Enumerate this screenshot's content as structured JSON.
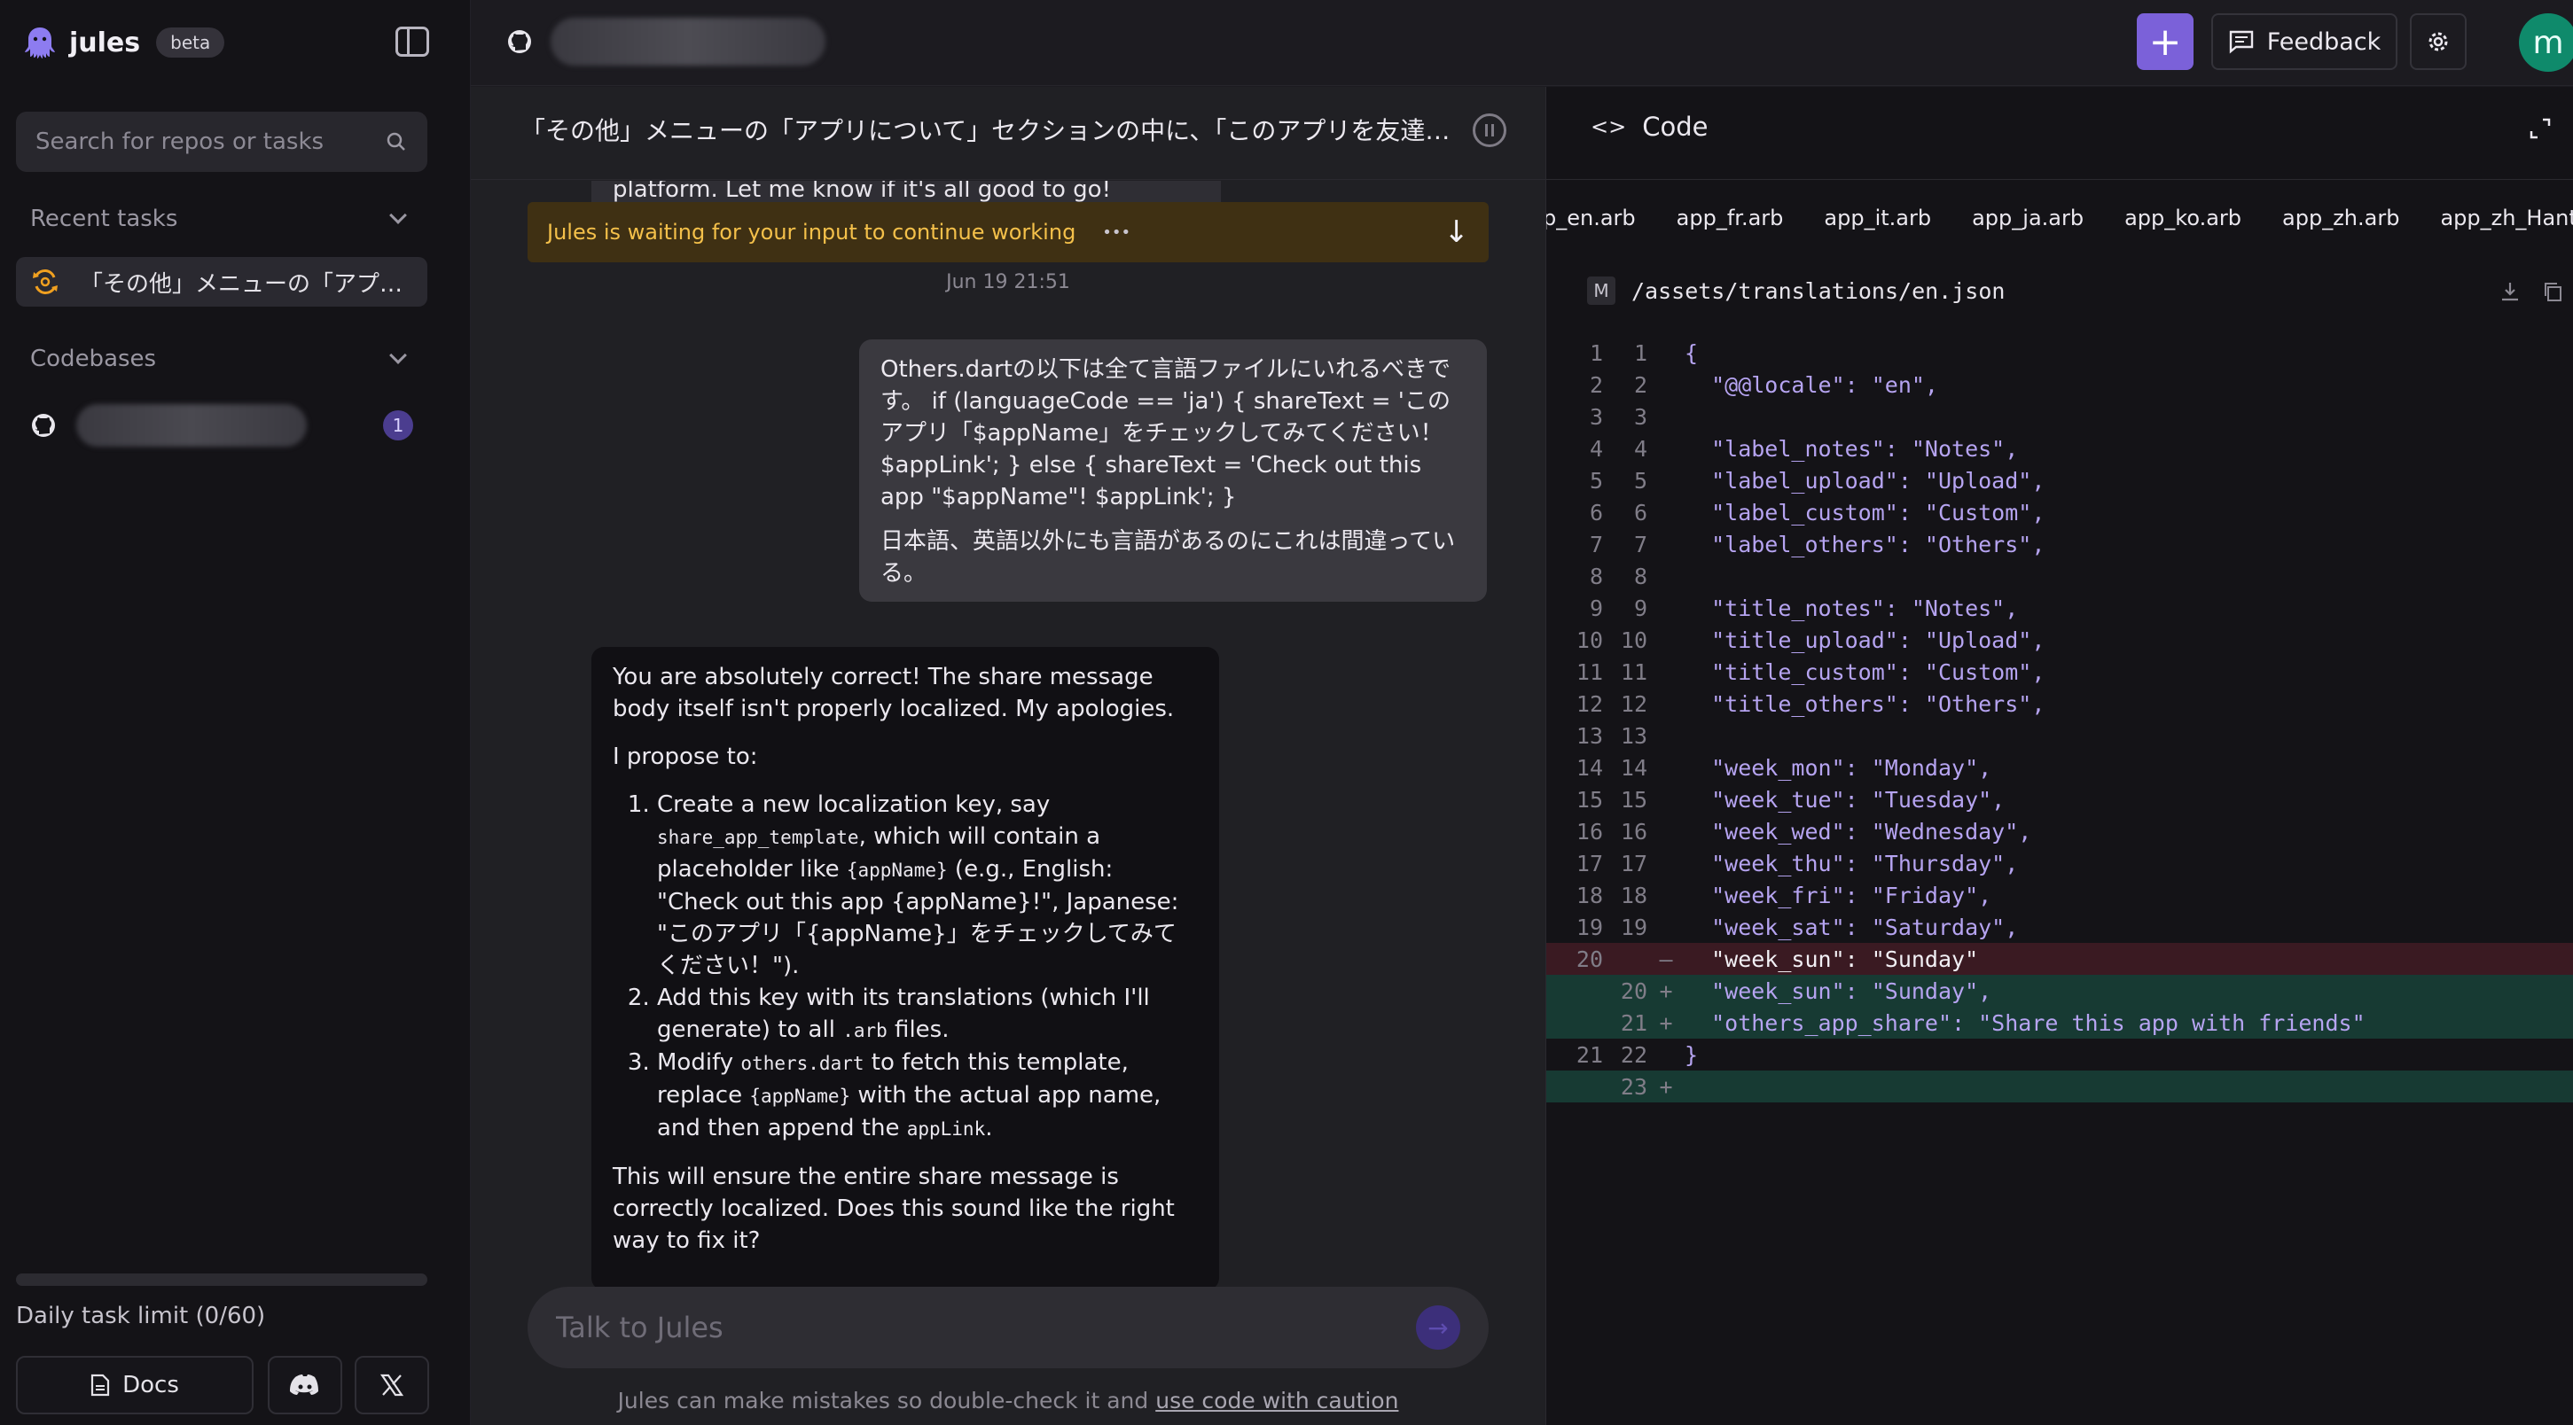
{
  "sidebar": {
    "brand": "jules",
    "badge": "beta",
    "search_placeholder": "Search for repos or tasks",
    "recent_label": "Recent tasks",
    "task_title": "「その他」メニューの「アプ…",
    "codebases_label": "Codebases",
    "codebase_count": "1",
    "limit_text": "Daily task limit (0/60)",
    "docs_label": "Docs"
  },
  "topbar": {
    "feedback_label": "Feedback",
    "avatar_letter": "m",
    "accent": "#7b61d9"
  },
  "chat": {
    "title": "「その他」メニューの「アプリについて」セクションの中に、「このアプリを友達…",
    "cut_text": "platform. Let me know if it's all good to go!",
    "waiting_text": "Jules is waiting for your input to continue working",
    "waiting_dots": "•••",
    "timestamp": "Jun 19 21:51",
    "user_p1": "Others.dartの以下は全て言語ファイルにいれるべきです。 if (languageCode == 'ja') { shareText = 'このアプリ「$appName」をチェックしてみてください！ $appLink'; } else { shareText = 'Check out this app \"$appName\"! $appLink'; }",
    "user_p2": "日本語、英語以外にも言語があるのにこれは間違っている。",
    "bot_p1": "You are absolutely correct! The share message body itself isn't properly localized. My apologies.",
    "bot_p2": "I propose to:",
    "bot_list": {
      "i1_a": "Create a new localization key, say ",
      "i1_code": "share_app_template",
      "i1_b": ", which will contain a placeholder like ",
      "i1_code2": "{appName}",
      "i1_c": " (e.g., English: \"Check out this app {appName}!\", Japanese: \"このアプリ「{appName}」をチェックしてみてください！\").",
      "i2_a": "Add this key with its translations (which I'll generate) to all ",
      "i2_code": ".arb",
      "i2_b": " files.",
      "i3_a": "Modify ",
      "i3_code": "others.dart",
      "i3_b": " to fetch this template, replace ",
      "i3_code2": "{appName}",
      "i3_c": " with the actual app name, and then append the ",
      "i3_code3": "appLink",
      "i3_d": "."
    },
    "bot_p3": "This will ensure the entire share message is correctly localized. Does this sound like the right way to fix it?",
    "input_placeholder": "Talk to Jules",
    "disclaimer": "Jules can make mistakes so double-check it and ",
    "disclaimer_link": "use code with caution"
  },
  "code": {
    "header": "Code",
    "file_tabs": [
      "p_en.arb",
      "app_fr.arb",
      "app_it.arb",
      "app_ja.arb",
      "app_ko.arb",
      "app_zh.arb",
      "app_zh_Hant.arb"
    ],
    "file_status": "M",
    "file_path": "/assets/translations/en.json",
    "lines": [
      {
        "a": "1",
        "b": "1",
        "m": "",
        "t": "{",
        "kind": ""
      },
      {
        "a": "2",
        "b": "2",
        "m": "",
        "t": "  \"@@locale\": \"en\",",
        "kind": ""
      },
      {
        "a": "3",
        "b": "3",
        "m": "",
        "t": "",
        "kind": ""
      },
      {
        "a": "4",
        "b": "4",
        "m": "",
        "t": "  \"label_notes\": \"Notes\",",
        "kind": ""
      },
      {
        "a": "5",
        "b": "5",
        "m": "",
        "t": "  \"label_upload\": \"Upload\",",
        "kind": ""
      },
      {
        "a": "6",
        "b": "6",
        "m": "",
        "t": "  \"label_custom\": \"Custom\",",
        "kind": ""
      },
      {
        "a": "7",
        "b": "7",
        "m": "",
        "t": "  \"label_others\": \"Others\",",
        "kind": ""
      },
      {
        "a": "8",
        "b": "8",
        "m": "",
        "t": "",
        "kind": ""
      },
      {
        "a": "9",
        "b": "9",
        "m": "",
        "t": "  \"title_notes\": \"Notes\",",
        "kind": ""
      },
      {
        "a": "10",
        "b": "10",
        "m": "",
        "t": "  \"title_upload\": \"Upload\",",
        "kind": ""
      },
      {
        "a": "11",
        "b": "11",
        "m": "",
        "t": "  \"title_custom\": \"Custom\",",
        "kind": ""
      },
      {
        "a": "12",
        "b": "12",
        "m": "",
        "t": "  \"title_others\": \"Others\",",
        "kind": ""
      },
      {
        "a": "13",
        "b": "13",
        "m": "",
        "t": "",
        "kind": ""
      },
      {
        "a": "14",
        "b": "14",
        "m": "",
        "t": "  \"week_mon\": \"Monday\",",
        "kind": ""
      },
      {
        "a": "15",
        "b": "15",
        "m": "",
        "t": "  \"week_tue\": \"Tuesday\",",
        "kind": ""
      },
      {
        "a": "16",
        "b": "16",
        "m": "",
        "t": "  \"week_wed\": \"Wednesday\",",
        "kind": ""
      },
      {
        "a": "17",
        "b": "17",
        "m": "",
        "t": "  \"week_thu\": \"Thursday\",",
        "kind": ""
      },
      {
        "a": "18",
        "b": "18",
        "m": "",
        "t": "  \"week_fri\": \"Friday\",",
        "kind": ""
      },
      {
        "a": "19",
        "b": "19",
        "m": "",
        "t": "  \"week_sat\": \"Saturday\",",
        "kind": ""
      },
      {
        "a": "20",
        "b": "",
        "m": "—",
        "t": "  \"week_sun\": \"Sunday\"",
        "kind": "del"
      },
      {
        "a": "",
        "b": "20",
        "m": "+",
        "t": "  \"week_sun\": \"Sunday\",",
        "kind": "add"
      },
      {
        "a": "",
        "b": "21",
        "m": "+",
        "t": "  \"others_app_share\": \"Share this app with friends\"",
        "kind": "add"
      },
      {
        "a": "21",
        "b": "22",
        "m": "",
        "t": "}",
        "kind": ""
      },
      {
        "a": "",
        "b": "23",
        "m": "+",
        "t": "",
        "kind": "add"
      }
    ]
  }
}
